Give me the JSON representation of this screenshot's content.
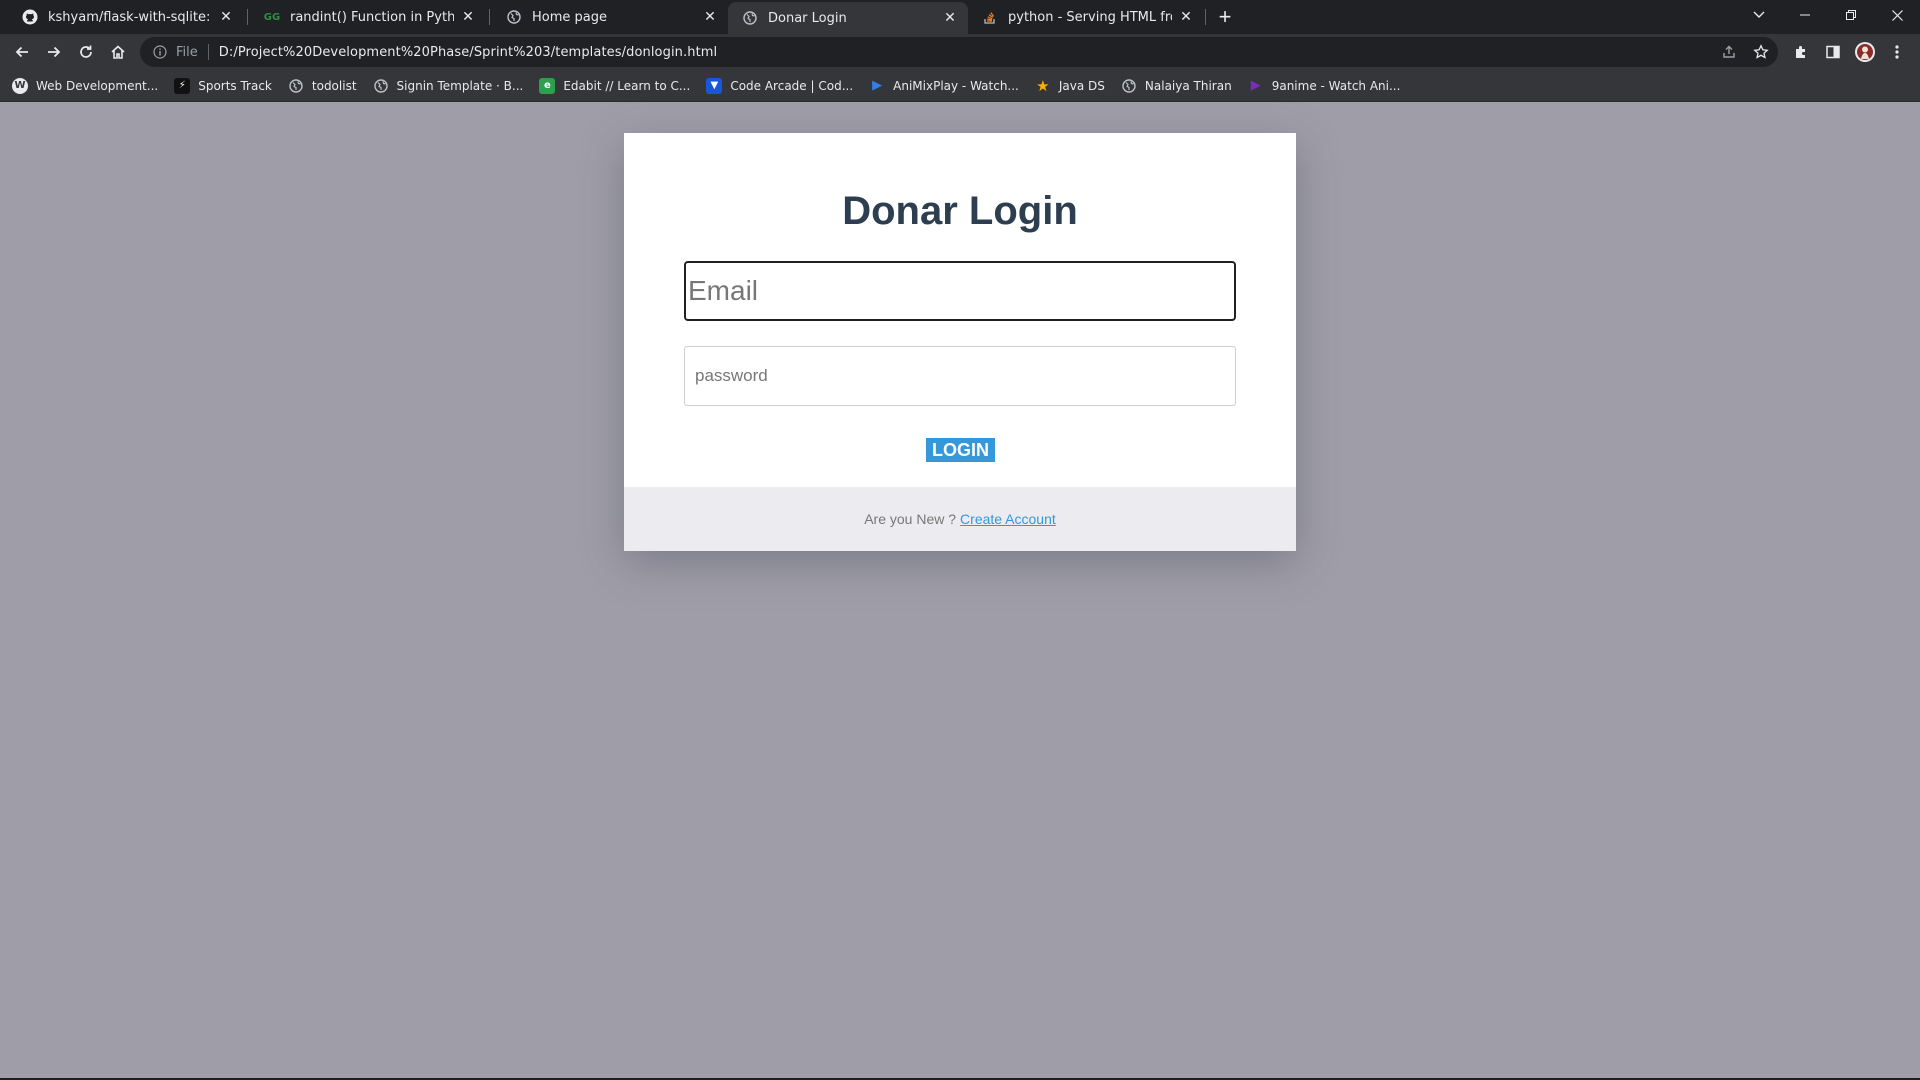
{
  "browser": {
    "tabs": [
      {
        "title": "kshyam/flask-with-sqlite: flask-w",
        "icon": "github-icon"
      },
      {
        "title": "randint() Function in Python - Ge",
        "icon": "geeksforgeeks-icon"
      },
      {
        "title": "Home page",
        "icon": "globe-icon"
      },
      {
        "title": "Donar Login",
        "icon": "globe-icon",
        "active": true
      },
      {
        "title": "python - Serving HTML from Flas",
        "icon": "stackoverflow-icon"
      }
    ],
    "address": {
      "scheme": "File",
      "url": "D:/Project%20Development%20Phase/Sprint%203/templates/donlogin.html"
    },
    "bookmarks": [
      {
        "label": "Web Development...",
        "icon": "letter-w-icon",
        "color": "#5f6368"
      },
      {
        "label": "Sports Track",
        "icon": "bolt-icon",
        "color": "#111111"
      },
      {
        "label": "todolist",
        "icon": "globe-icon",
        "color": "#5f6368"
      },
      {
        "label": "Signin Template · B...",
        "icon": "globe-icon",
        "color": "#5f6368"
      },
      {
        "label": "Edabit // Learn to C...",
        "icon": "edabit-icon",
        "color": "#2e9e4f"
      },
      {
        "label": "Code Arcade | Cod...",
        "icon": "codearcade-icon",
        "color": "#1a56db"
      },
      {
        "label": "AniMixPlay - Watch...",
        "icon": "animixplay-icon",
        "color": "#2f80ed"
      },
      {
        "label": "Java DS",
        "icon": "star-icon",
        "color": "#f4b400"
      },
      {
        "label": "Nalaiya Thiran",
        "icon": "globe-icon",
        "color": "#5f6368"
      },
      {
        "label": "9anime - Watch Ani...",
        "icon": "9anime-icon",
        "color": "#7b2cbf"
      }
    ]
  },
  "page": {
    "title": "Donar Login",
    "email_placeholder": "Email",
    "password_placeholder": "password",
    "login_label": "LOGIN",
    "footer_text": "Are you New ?",
    "footer_link": "Create Account"
  },
  "colors": {
    "page_bg": "#9f9ea8",
    "accent": "#3498db",
    "title": "#2c3e50"
  }
}
